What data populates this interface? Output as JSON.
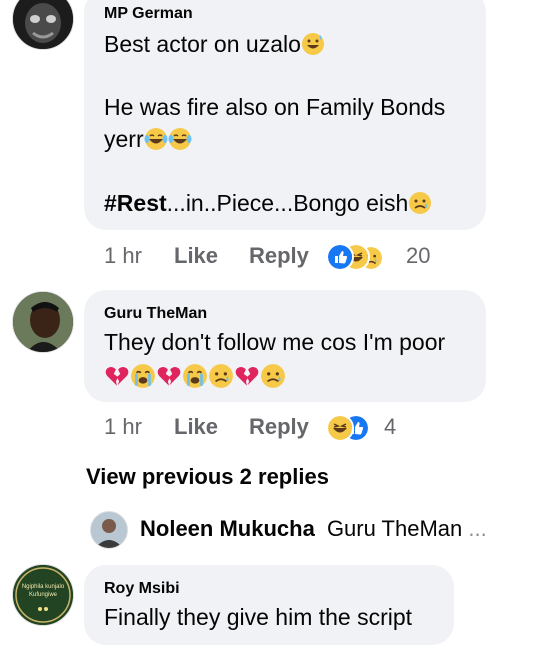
{
  "comments": [
    {
      "author": "MP German",
      "line1": "Best actor on uzalo",
      "line2": "He was fire also on Family Bonds",
      "line3": "yerr",
      "hashtag": "#Rest",
      "line4_rest": "...in..Piece...Bongo eish",
      "time": "1 hr",
      "like": "Like",
      "reply": "Reply",
      "reactions": [
        "like",
        "haha",
        "sad"
      ],
      "count": "20"
    },
    {
      "author": "Guru TheMan",
      "line1": "They don't follow me cos I'm poor",
      "time": "1 hr",
      "like": "Like",
      "reply": "Reply",
      "reactions": [
        "haha",
        "like"
      ],
      "count": "4"
    },
    {
      "author": "Roy Msibi",
      "line1": "Finally they give him the script",
      "avatar_text": "Ngiphila kunjalo Kufungiwe"
    }
  ],
  "view_previous": "View previous 2 replies",
  "reply_preview": {
    "author": "Noleen Mukucha",
    "snippet": "Guru TheMan",
    "ellipsis": "..."
  },
  "colors": {
    "bubble": "#f0f2f5",
    "meta": "#65676b",
    "like_blue": "#1877f2",
    "emoji_yellow": "#f7c948",
    "heart_red": "#e0245e"
  }
}
